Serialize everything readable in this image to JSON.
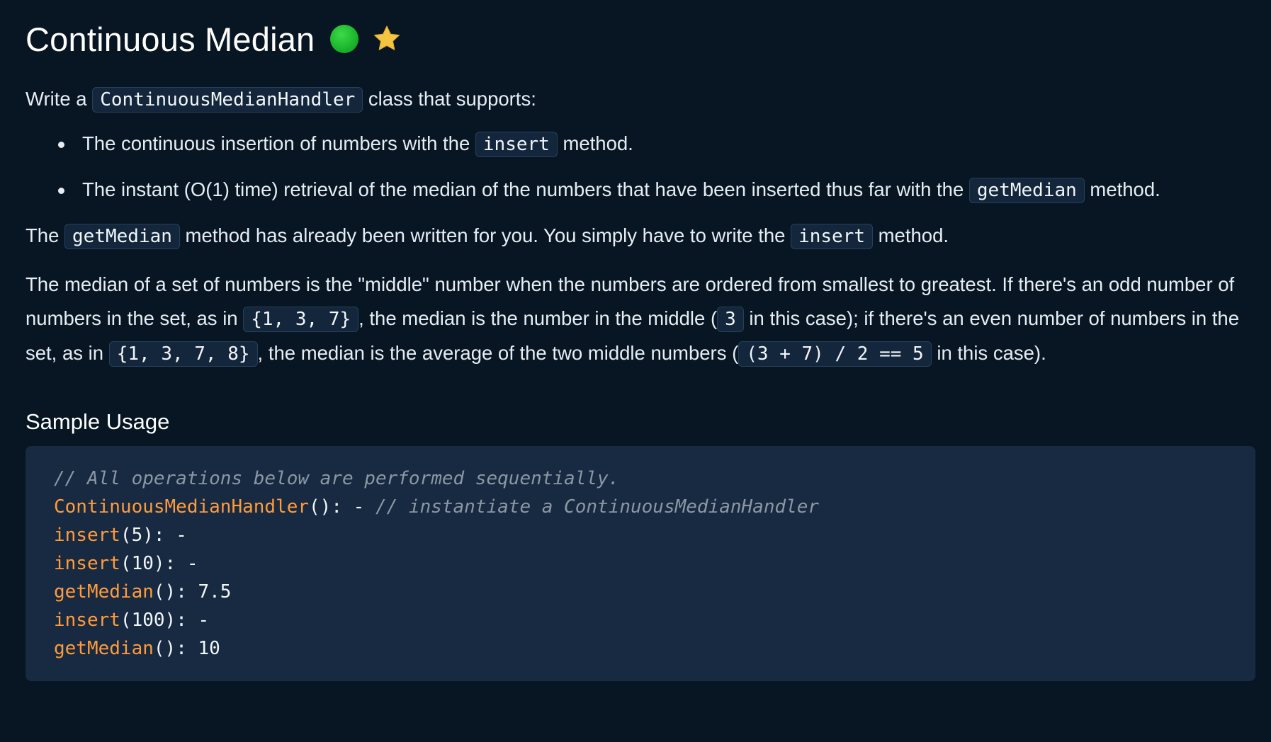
{
  "header": {
    "title": "Continuous Median",
    "difficulty_icon": "green-circle",
    "favorite_icon": "star"
  },
  "description": {
    "p1": {
      "pre": "Write a ",
      "code": "ContinuousMedianHandler",
      "post": " class that supports:"
    },
    "bullets": [
      {
        "pre": "The continuous insertion of numbers with the ",
        "code": "insert",
        "post": " method."
      },
      {
        "pre": "The instant (O(1) time) retrieval of the median of the numbers that have been inserted thus far with the ",
        "code": "getMedian",
        "post": " method."
      }
    ],
    "p2": {
      "t1": "The ",
      "c1": "getMedian",
      "t2": " method has already been written for you. You simply have to write the ",
      "c2": "insert",
      "t3": " method."
    },
    "p3": {
      "t1": "The median of a set of numbers is the \"middle\" number when the numbers are ordered from smallest to greatest. If there's an odd number of numbers in the set, as in ",
      "c1": "{1, 3, 7}",
      "t2": ", the median is the number in the middle (",
      "c2": "3",
      "t3": " in this case); if there's an even number of numbers in the set, as in ",
      "c3": "{1, 3, 7, 8}",
      "t4": ", the median is the average of the two middle numbers (",
      "c4": "(3 + 7) / 2 == 5",
      "t5": " in this case)."
    }
  },
  "sample": {
    "heading": "Sample Usage",
    "lines": [
      {
        "comment": "// All operations below are performed sequentially."
      },
      {
        "fn": "ContinuousMedianHandler",
        "rest": "(): - ",
        "comment": "// instantiate a ContinuousMedianHandler"
      },
      {
        "fn": "insert",
        "rest": "(5): -"
      },
      {
        "fn": "insert",
        "rest": "(10): -"
      },
      {
        "fn": "getMedian",
        "rest": "(): 7.5"
      },
      {
        "fn": "insert",
        "rest": "(100): -"
      },
      {
        "fn": "getMedian",
        "rest": "(): 10"
      }
    ]
  },
  "colors": {
    "background": "#081624",
    "code_background": "#172a41",
    "function": "#ff9b3d",
    "comment": "#8c97a3",
    "difficulty_green": "#19b52a",
    "star": "#f5c542"
  }
}
